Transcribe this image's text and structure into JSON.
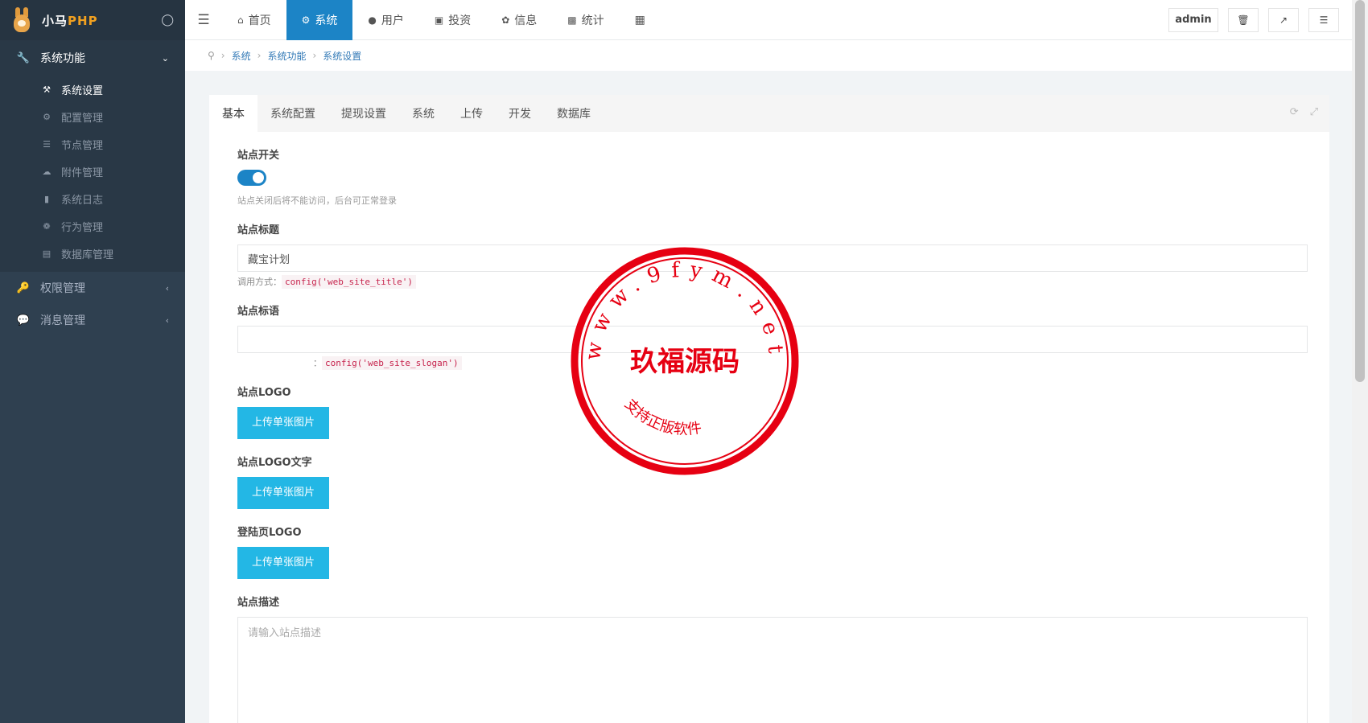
{
  "brand": {
    "prefix": "小马",
    "php": "PHP"
  },
  "sidebar": {
    "groups": [
      {
        "label": "系统功能",
        "icon": "wrench-icon",
        "expanded": true
      },
      {
        "label": "权限管理",
        "icon": "key-icon",
        "expanded": false
      },
      {
        "label": "消息管理",
        "icon": "comments-icon",
        "expanded": false
      }
    ],
    "items": [
      {
        "label": "系统设置",
        "icon": "wrench-icon",
        "active": true
      },
      {
        "label": "配置管理",
        "icon": "cogs-icon"
      },
      {
        "label": "节点管理",
        "icon": "list-icon"
      },
      {
        "label": "附件管理",
        "icon": "cloud-upload-icon"
      },
      {
        "label": "系统日志",
        "icon": "book-icon"
      },
      {
        "label": "行为管理",
        "icon": "bug-icon"
      },
      {
        "label": "数据库管理",
        "icon": "database-icon"
      }
    ]
  },
  "topnav": {
    "items": [
      {
        "label": "首页",
        "icon": "home-icon"
      },
      {
        "label": "系统",
        "icon": "gear-icon",
        "active": true
      },
      {
        "label": "用户",
        "icon": "user-icon"
      },
      {
        "label": "投资",
        "icon": "briefcase-icon"
      },
      {
        "label": "信息",
        "icon": "yelp-icon"
      },
      {
        "label": "统计",
        "icon": "bar-chart-icon"
      }
    ],
    "avatar_alt": "admin"
  },
  "breadcrumb": [
    "系统",
    "系统功能",
    "系统设置"
  ],
  "tabs": [
    "基本",
    "系统配置",
    "提现设置",
    "系统",
    "上传",
    "开发",
    "数据库"
  ],
  "form": {
    "site_switch": {
      "label": "站点开关",
      "on": true,
      "help": "站点关闭后将不能访问，后台可正常登录"
    },
    "site_title": {
      "label": "站点标题",
      "value": "藏宝计划",
      "usage_prefix": "调用方式：",
      "usage_code": "config('web_site_title')"
    },
    "site_slogan": {
      "label": "站点标语",
      "value": "",
      "usage_suffix": "：",
      "usage_code": "config('web_site_slogan')"
    },
    "site_logo": {
      "label": "站点LOGO",
      "button": "上传单张图片"
    },
    "site_logo_text": {
      "label": "站点LOGO文字",
      "button": "上传单张图片"
    },
    "login_logo": {
      "label": "登陆页LOGO",
      "button": "上传单张图片"
    },
    "site_desc": {
      "label": "站点描述",
      "placeholder": "请输入站点描述"
    }
  },
  "watermark": {
    "url": "www.9fym.net",
    "name": "玖福源码",
    "subname": "玖福源码",
    "footer": "支持正版软件"
  },
  "colors": {
    "sidebar": "#2f4050",
    "accent": "#1c84c6",
    "upload": "#23b7e5",
    "stamp": "#e60012"
  }
}
